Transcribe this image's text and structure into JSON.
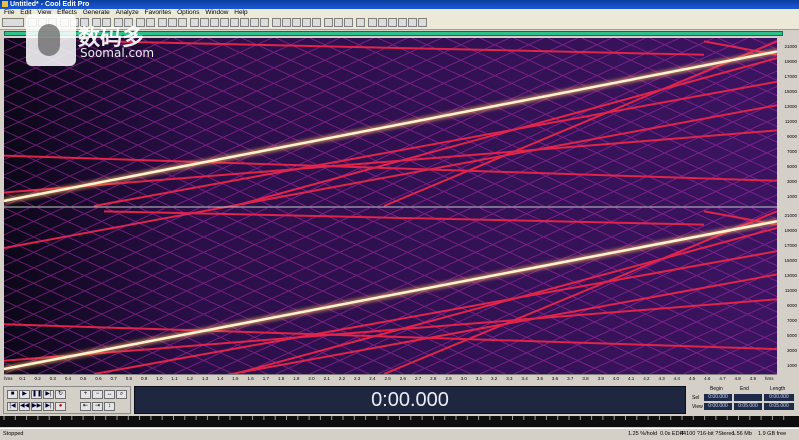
{
  "window": {
    "title": "Untitled* - Cool Edit Pro"
  },
  "menu": [
    "File",
    "Edit",
    "View",
    "Effects",
    "Generate",
    "Analyze",
    "Favorites",
    "Options",
    "Window",
    "Help"
  ],
  "watermark": {
    "chinese": "数码多",
    "english": "Soomal.com"
  },
  "time_display": "0:00.000",
  "freq_ticks": [
    "21000",
    "19000",
    "17000",
    "15000",
    "13000",
    "11000",
    "9000",
    "7000",
    "5000",
    "3000",
    "1000"
  ],
  "time_ticks": [
    "hms",
    "0.1",
    "0.2",
    "0.3",
    "0.4",
    "0.5",
    "0.6",
    "0.7",
    "0.8",
    "0.9",
    "1.0",
    "1.1",
    "1.2",
    "1.3",
    "1.4",
    "1.5",
    "1.6",
    "1.7",
    "1.8",
    "1.9",
    "2.0",
    "2.1",
    "2.2",
    "2.3",
    "2.4",
    "2.5",
    "2.6",
    "2.7",
    "2.8",
    "2.9",
    "3.0",
    "3.1",
    "3.2",
    "3.3",
    "3.4",
    "3.5",
    "3.6",
    "3.7",
    "3.8",
    "3.9",
    "4.0",
    "4.1",
    "4.2",
    "4.3",
    "4.4",
    "4.5",
    "4.6",
    "4.7",
    "4.8",
    "4.9",
    "hms"
  ],
  "selection": {
    "begin_label": "Begin",
    "end_label": "End",
    "length_label": "Length",
    "sel_label": "Sel",
    "view_label": "View",
    "sel_begin": "0:00.000",
    "sel_end": "",
    "sel_length": "0:00.000",
    "view_begin": "0:00.000",
    "view_end": "0:05.000",
    "view_length": "0:05.000"
  },
  "status": {
    "left": "Stopped",
    "items": [
      "1.25 %/hold",
      "0.0s EDIT",
      "44100 ?16-bit ?Stereo",
      "1.56 Mb",
      "1.9 GB free"
    ]
  }
}
